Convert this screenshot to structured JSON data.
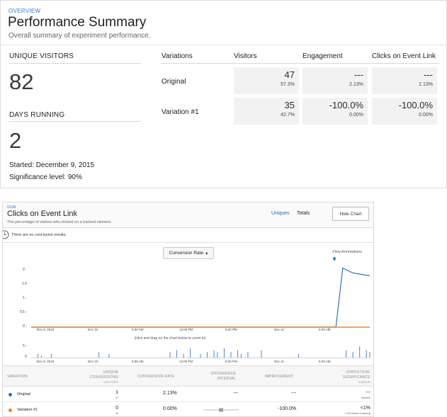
{
  "overview": {
    "label": "OVERVIEW",
    "title": "Performance Summary",
    "subtitle": "Overall summary of experiment performance."
  },
  "stats": {
    "unique_visitors_label": "UNIQUE VISITORS",
    "unique_visitors_value": "82",
    "days_running_label": "DAYS RUNNING",
    "days_running_value": "2",
    "started": "Started: December 9, 2015",
    "significance": "Significance level: 90%"
  },
  "summary_table": {
    "headers": [
      "Variations",
      "Visitors",
      "Engagement",
      "Clicks on Event Link"
    ],
    "rows": [
      {
        "name": "Original",
        "visitors": "47",
        "visitors_pct": "57.3%",
        "engagement": "---",
        "engagement_rate": "2.13%",
        "clicks": "---",
        "clicks_rate": "2.13%"
      },
      {
        "name": "Variation #1",
        "visitors": "35",
        "visitors_pct": "42.7%",
        "engagement": "-100.0%",
        "engagement_rate": "0.00%",
        "clicks": "-100.0%",
        "clicks_rate": "0.00%"
      }
    ]
  },
  "goal": {
    "tag": "GOAL",
    "title": "Clicks on Event Link",
    "subtitle": "The percentage of visitors who clicked on a tracked element.",
    "toggle_uniques": "Uniques",
    "toggle_totals": "Totals",
    "hide_chart": "Hide Chart",
    "notice": "There are no conclusive results.",
    "dropdown": "Conversion Rate",
    "view_annotations": "View Annotations",
    "zoom_hint": "[click and drag on the chart below to zoom in]"
  },
  "colors": {
    "original": "#2f6fc9",
    "variation": "#f07d1a",
    "accent": "#3a7bd5"
  },
  "chart_data": {
    "type": "line",
    "y_ticks": [
      "2 -",
      "1.5",
      "1 -",
      "0.5 -",
      "0 -"
    ],
    "x_ticks": [
      "Dec 9, 2015",
      "Dec 10",
      "6:00 AM",
      "12:00 PM",
      "6:00 PM",
      "Dec 11",
      "6:00 AM"
    ],
    "mini_y_ticks": [
      "5 -",
      "0"
    ],
    "ylim": [
      0,
      2.4
    ],
    "x": [
      0,
      0.88,
      0.9,
      0.92,
      0.95,
      1.0
    ],
    "series": [
      {
        "name": "Original",
        "values": [
          0,
          0,
          0,
          2.13,
          1.95,
          1.85
        ]
      },
      {
        "name": "Variation #1",
        "values": [
          0,
          0,
          0,
          0,
          0,
          0
        ]
      }
    ],
    "mini_bars": [
      [
        0.02,
        2
      ],
      [
        0.03,
        1
      ],
      [
        0.06,
        2
      ],
      [
        0.2,
        3
      ],
      [
        0.23,
        2
      ],
      [
        0.41,
        3
      ],
      [
        0.43,
        4
      ],
      [
        0.45,
        2
      ],
      [
        0.47,
        5
      ],
      [
        0.5,
        2
      ],
      [
        0.52,
        3
      ],
      [
        0.54,
        4
      ],
      [
        0.55,
        3
      ],
      [
        0.57,
        5
      ],
      [
        0.59,
        3
      ],
      [
        0.61,
        4
      ],
      [
        0.62,
        2
      ],
      [
        0.64,
        3
      ],
      [
        0.68,
        4
      ],
      [
        0.79,
        2
      ],
      [
        0.93,
        4
      ],
      [
        0.95,
        3
      ],
      [
        0.97,
        6
      ],
      [
        0.99,
        4
      ],
      [
        1.0,
        3
      ]
    ]
  },
  "variation_table": {
    "headers": {
      "variation": "VARIATION",
      "unique_conv_1": "UNIQUE",
      "unique_conv_2": "CONVERSIONS",
      "unique_conv_3": "VISITORS",
      "conv_rate": "CONVERSION RATE",
      "diff_1": "DIFFERENCE",
      "diff_2": "INTERVAL",
      "improvement": "IMPROVEMENT",
      "sig_1": "STATISTICAL",
      "sig_2": "SIGNIFICANCE",
      "sig_3": "STATUS"
    },
    "rows": [
      {
        "name": "Original",
        "conversions": "1",
        "visitors": "47",
        "rate": "2.13%",
        "interval": "---",
        "improvement": "---",
        "significance": "---",
        "sig_note": "baseline"
      },
      {
        "name": "Variation #1",
        "conversions": "0",
        "visitors": "35",
        "rate": "0.00%",
        "interval": "",
        "improvement": "-100.0%",
        "significance": "<1%",
        "sig_note": "> 100 visitors remaining"
      }
    ]
  }
}
